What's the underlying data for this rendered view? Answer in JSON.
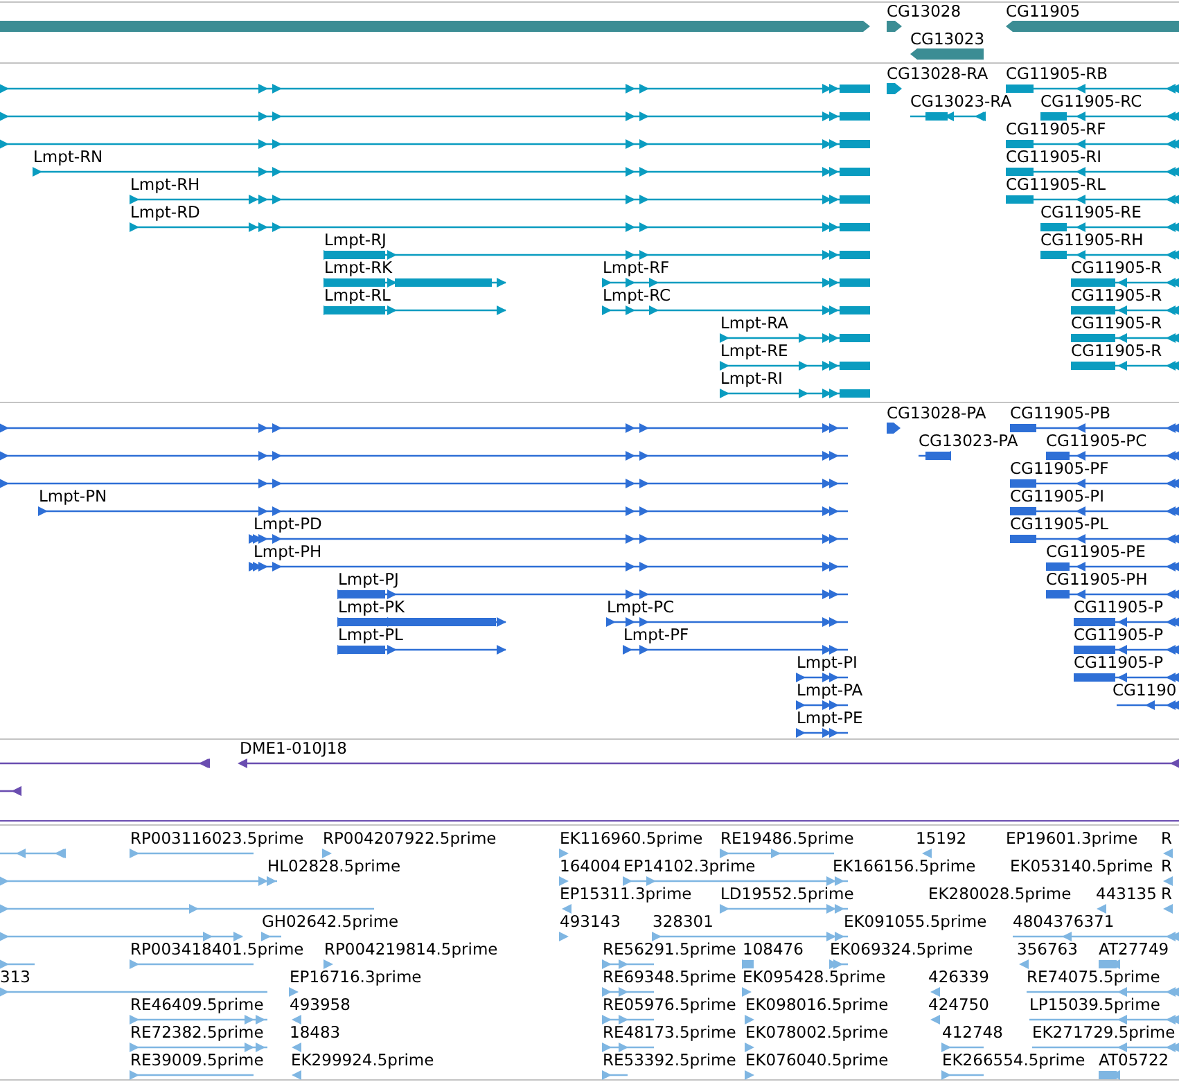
{
  "tracks": [
    {
      "kind": "gene",
      "features": [
        {
          "reverse": false
        },
        {
          "label": "CG13028",
          "reverse": false
        },
        {
          "label": "CG11905",
          "reverse": true
        },
        {
          "label": "CG13023",
          "reverse": true
        }
      ]
    },
    {
      "kind": "transcript",
      "features": [
        {
          "reverse": false
        },
        {
          "reverse": false
        },
        {
          "reverse": false
        },
        {
          "label": "Lmpt-RN",
          "reverse": false
        },
        {
          "label": "Lmpt-RH",
          "reverse": false
        },
        {
          "label": "Lmpt-RD",
          "reverse": false
        },
        {
          "label": "Lmpt-RJ",
          "reverse": false
        },
        {
          "label": "Lmpt-RK",
          "reverse": false
        },
        {
          "label": "Lmpt-RF",
          "reverse": false
        },
        {
          "label": "Lmpt-RL",
          "reverse": false
        },
        {
          "label": "Lmpt-RC",
          "reverse": false
        },
        {
          "label": "Lmpt-RA",
          "reverse": false
        },
        {
          "label": "Lmpt-RE",
          "reverse": false
        },
        {
          "label": "Lmpt-RI",
          "reverse": false
        },
        {
          "label": "CG13028-RA",
          "reverse": false
        },
        {
          "label": "CG13023-RA",
          "reverse": true
        },
        {
          "label": "CG11905-RB",
          "reverse": true
        },
        {
          "label": "CG11905-RC",
          "reverse": true
        },
        {
          "label": "CG11905-RF",
          "reverse": true
        },
        {
          "label": "CG11905-RI",
          "reverse": true
        },
        {
          "label": "CG11905-RL",
          "reverse": true
        },
        {
          "label": "CG11905-RE",
          "reverse": true
        },
        {
          "label": "CG11905-RH",
          "reverse": true
        },
        {
          "label": "CG11905-R",
          "reverse": true
        },
        {
          "label": "CG11905-R",
          "reverse": true
        },
        {
          "label": "CG11905-R",
          "reverse": true
        },
        {
          "label": "CG11905-R",
          "reverse": true
        }
      ]
    },
    {
      "kind": "protein",
      "features": [
        {
          "reverse": false
        },
        {
          "reverse": false
        },
        {
          "reverse": false
        },
        {
          "label": "Lmpt-PN",
          "reverse": false
        },
        {
          "label": "Lmpt-PD",
          "reverse": false
        },
        {
          "label": "Lmpt-PH",
          "reverse": false
        },
        {
          "label": "Lmpt-PJ",
          "reverse": false
        },
        {
          "label": "Lmpt-PK",
          "reverse": false
        },
        {
          "label": "Lmpt-PC",
          "reverse": false
        },
        {
          "label": "Lmpt-PL",
          "reverse": false
        },
        {
          "label": "Lmpt-PF",
          "reverse": false
        },
        {
          "label": "Lmpt-PI",
          "reverse": false
        },
        {
          "label": "Lmpt-PA",
          "reverse": false
        },
        {
          "label": "Lmpt-PE",
          "reverse": false
        },
        {
          "label": "CG13028-PA",
          "reverse": false
        },
        {
          "label": "CG13023-PA",
          "reverse": true
        },
        {
          "label": "CG11905-PB",
          "reverse": true
        },
        {
          "label": "CG11905-PC",
          "reverse": true
        },
        {
          "label": "CG11905-PF",
          "reverse": true
        },
        {
          "label": "CG11905-PI",
          "reverse": true
        },
        {
          "label": "CG11905-PL",
          "reverse": true
        },
        {
          "label": "CG11905-PE",
          "reverse": true
        },
        {
          "label": "CG11905-PH",
          "reverse": true
        },
        {
          "label": "CG11905-P",
          "reverse": true
        },
        {
          "label": "CG11905-P",
          "reverse": true
        },
        {
          "label": "CG11905-P",
          "reverse": true
        },
        {
          "label": "CG1190",
          "reverse": true
        }
      ]
    },
    {
      "kind": "clone",
      "features": [
        {
          "reverse": true
        },
        {
          "label": "DME1-010J18",
          "reverse": true
        },
        {
          "reverse": true
        }
      ]
    },
    {
      "kind": "est",
      "features": [
        {
          "reverse": true
        },
        {
          "label": "RP003116023.5prime",
          "reverse": false
        },
        {
          "label": "RP004207922.5prime",
          "reverse": false
        },
        {
          "label": "EK116960.5prime",
          "reverse": false
        },
        {
          "label": "RE19486.5prime",
          "reverse": false
        },
        {
          "label": "15192",
          "reverse": true
        },
        {
          "label": "EP19601.3prime"
        },
        {
          "label": "R",
          "reverse": true
        },
        {
          "reverse": false
        },
        {
          "label": "HL02828.5prime",
          "reverse": false
        },
        {
          "label": "164004",
          "reverse": false
        },
        {
          "label": "EP14102.3prime",
          "reverse": false
        },
        {
          "label": "EK166156.5prime"
        },
        {
          "label": "EK053140.5prime"
        },
        {
          "label": "R",
          "reverse": true
        },
        {
          "reverse": false
        },
        {
          "label": "EP15311.3prime",
          "reverse": true
        },
        {
          "label": "LD19552.5prime",
          "reverse": false
        },
        {
          "label": "EK280028.5prime"
        },
        {
          "label": "443135",
          "reverse": true
        },
        {
          "label": "R",
          "reverse": true
        },
        {
          "reverse": false
        },
        {
          "label": "GH02642.5prime",
          "reverse": false
        },
        {
          "label": "493143",
          "reverse": false
        },
        {
          "label": "328301",
          "reverse": false
        },
        {
          "label": "EK091055.5prime"
        },
        {
          "label": "4804376371",
          "reverse": true
        },
        {
          "reverse": false
        },
        {
          "label": "RP003418401.5prime",
          "reverse": false
        },
        {
          "label": "RP004219814.5prime",
          "reverse": false
        },
        {
          "label": "RE56291.5prime",
          "reverse": false
        },
        {
          "label": "108476",
          "reverse": false
        },
        {
          "label": "EK069324.5prime",
          "reverse": false
        },
        {
          "label": "356763",
          "reverse": true
        },
        {
          "label": "AT27749",
          "reverse": true
        },
        {
          "label": "313",
          "reverse": false
        },
        {
          "label": "EP16716.3prime",
          "reverse": false
        },
        {
          "label": "RE69348.5prime",
          "reverse": false
        },
        {
          "label": "EK095428.5prime",
          "reverse": false
        },
        {
          "label": "426339",
          "reverse": true
        },
        {
          "label": "RE74075.5prime",
          "reverse": true
        },
        {
          "label": "RE46409.5prime",
          "reverse": false
        },
        {
          "label": "493958",
          "reverse": true
        },
        {
          "label": "RE05976.5prime",
          "reverse": false
        },
        {
          "label": "EK098016.5prime",
          "reverse": false
        },
        {
          "label": "424750",
          "reverse": true
        },
        {
          "label": "LP15039.5prime",
          "reverse": true
        },
        {
          "label": "RE72382.5prime",
          "reverse": false
        },
        {
          "label": "18483",
          "reverse": true
        },
        {
          "label": "RE48173.5prime",
          "reverse": false
        },
        {
          "label": "EK078002.5prime",
          "reverse": false
        },
        {
          "label": "412748",
          "reverse": false
        },
        {
          "label": "EK271729.5prime",
          "reverse": true
        },
        {
          "label": "RE39009.5prime",
          "reverse": false
        },
        {
          "label": "EK299924.5prime",
          "reverse": true
        },
        {
          "label": "RE53392.5prime",
          "reverse": false
        },
        {
          "label": "EK076040.5prime",
          "reverse": false
        },
        {
          "label": "EK266554.5prime",
          "reverse": false
        },
        {
          "label": "AT05722",
          "reverse": true
        }
      ]
    }
  ]
}
